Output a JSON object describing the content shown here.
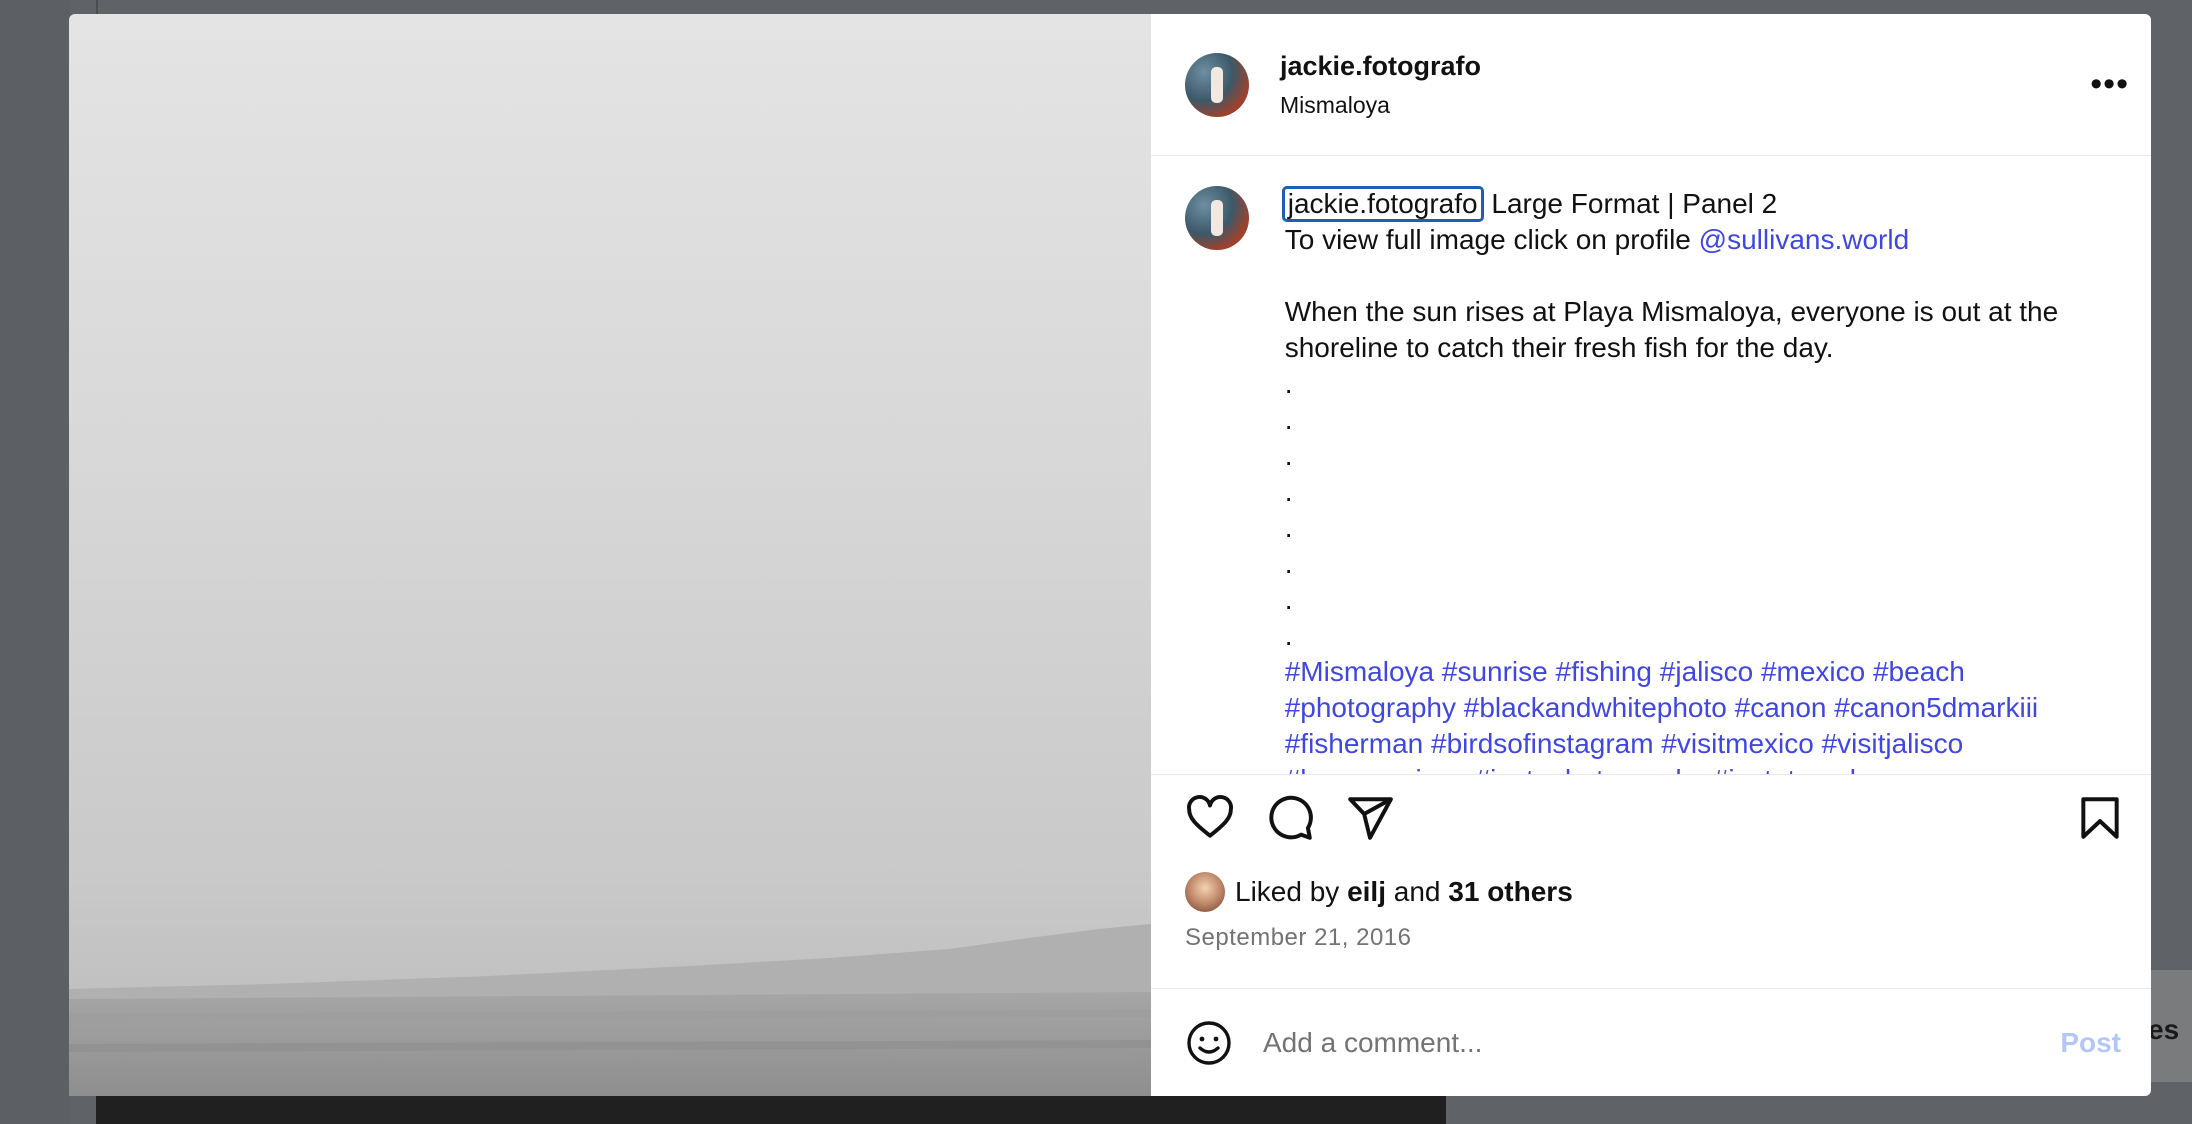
{
  "post": {
    "username": "jackie.fotografo",
    "location": "Mismaloya",
    "more_label": "•••"
  },
  "caption": {
    "owner": "jackie.fotografo",
    "title": "Large Format | Panel 2",
    "line2_prefix": "To view full image click on profile ",
    "mention": "@sullivans.world",
    "body": "When the sun rises at Playa Mismaloya, everyone is out at the shoreline to catch their fresh fish for the day.",
    "dots": [
      ".",
      ".",
      ".",
      ".",
      ".",
      ".",
      ".",
      "."
    ],
    "hashtags_line1": "#Mismaloya #sunrise #fishing #jalisco #mexico #beach",
    "hashtags_line2": "#photography #blackandwhitephoto #canon #canon5dmarkiii",
    "hashtags_line3": "#fisherman #birdsofinstagram #visitmexico #visitjalisco",
    "hashtags_line4": "#lovemornings #instaphotography #instatravel"
  },
  "likes": {
    "prefix": "Liked by",
    "user": "eilj",
    "joiner": "and",
    "others": "31 others"
  },
  "date": "September 21, 2016",
  "comment": {
    "placeholder": "Add a comment...",
    "post_label": "Post"
  },
  "background": {
    "side_text": "es"
  },
  "colors": {
    "link": "#3f47e0",
    "focus_ring": "#1d5fb8",
    "post_disabled": "#b3c7f7",
    "secondary_text": "#737373"
  },
  "icons": [
    "heart-icon",
    "comment-icon",
    "share-icon",
    "bookmark-icon",
    "emoji-icon",
    "more-icon"
  ]
}
